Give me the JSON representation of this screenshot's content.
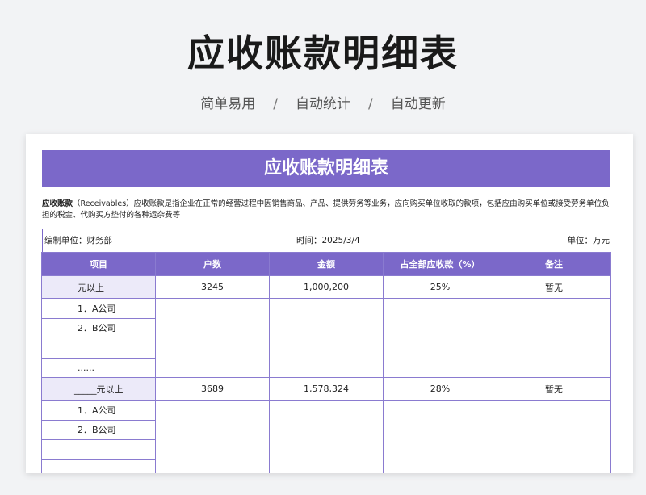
{
  "header": {
    "title": "应收账款明细表",
    "subtitle_parts": [
      "简单易用",
      "自动统计",
      "自动更新"
    ],
    "separator": "/"
  },
  "sheet": {
    "banner_title": "应收账款明细表",
    "desc_term": "应收账款",
    "desc_body": "（Receivables）应收账款是指企业在正常的经营过程中因销售商品、产品、提供劳务等业务，应向购买单位收取的款项，包括应由购买单位或接受劳务单位负担的税金、代购买方垫付的各种运杂费等",
    "meta": {
      "unit_label": "编制单位：财务部",
      "time_label": "时间：2025/3/4",
      "currency_label": "单位：万元"
    },
    "columns": [
      "项目",
      "户数",
      "金额",
      "占全部应收款（%）",
      "备注"
    ],
    "groups": [
      {
        "label": "元以上",
        "count": "3245",
        "amount": "1,000,200",
        "percent": "25%",
        "note": "暂无",
        "items": [
          "1．A公司",
          "2．B公司",
          "",
          "......"
        ]
      },
      {
        "label": "_____元以上",
        "count": "3689",
        "amount": "1,578,324",
        "percent": "28%",
        "note": "暂无",
        "items": [
          "1．A公司",
          "2．B公司",
          "",
          ""
        ]
      }
    ]
  }
}
